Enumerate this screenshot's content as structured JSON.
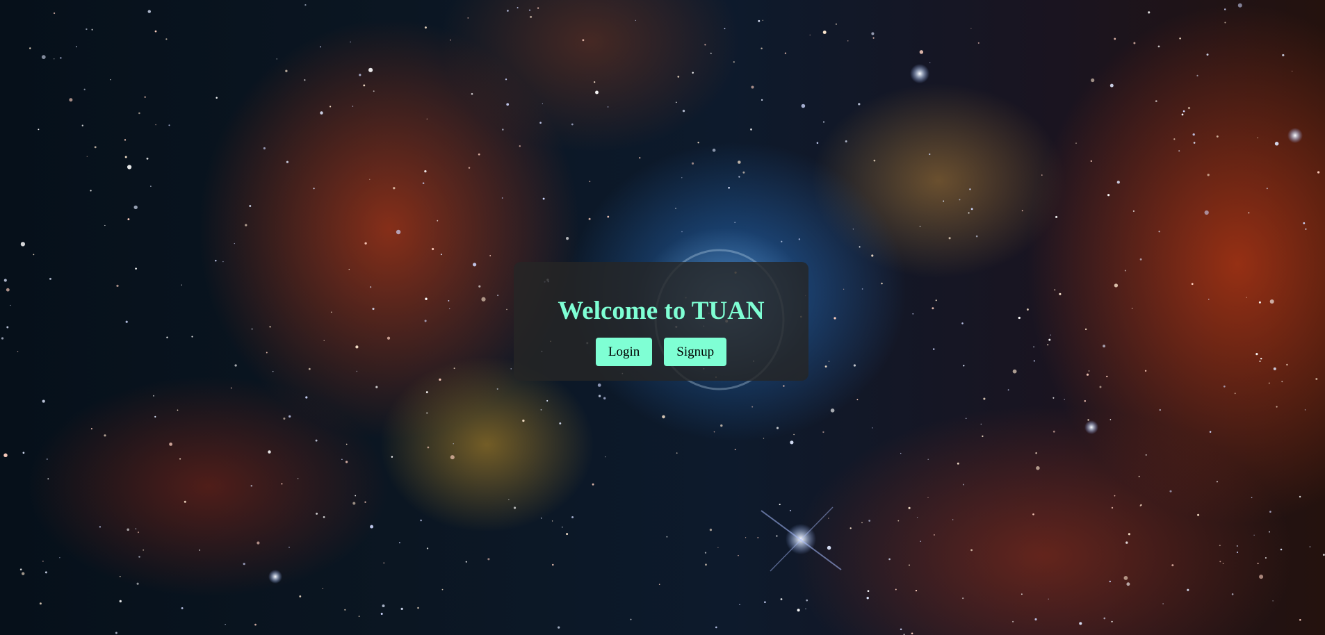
{
  "background": {
    "description_icon": "nebula-background",
    "accent_color": "#7fffd4"
  },
  "welcome": {
    "title": "Welcome to TUAN",
    "login_label": "Login",
    "signup_label": "Signup"
  }
}
